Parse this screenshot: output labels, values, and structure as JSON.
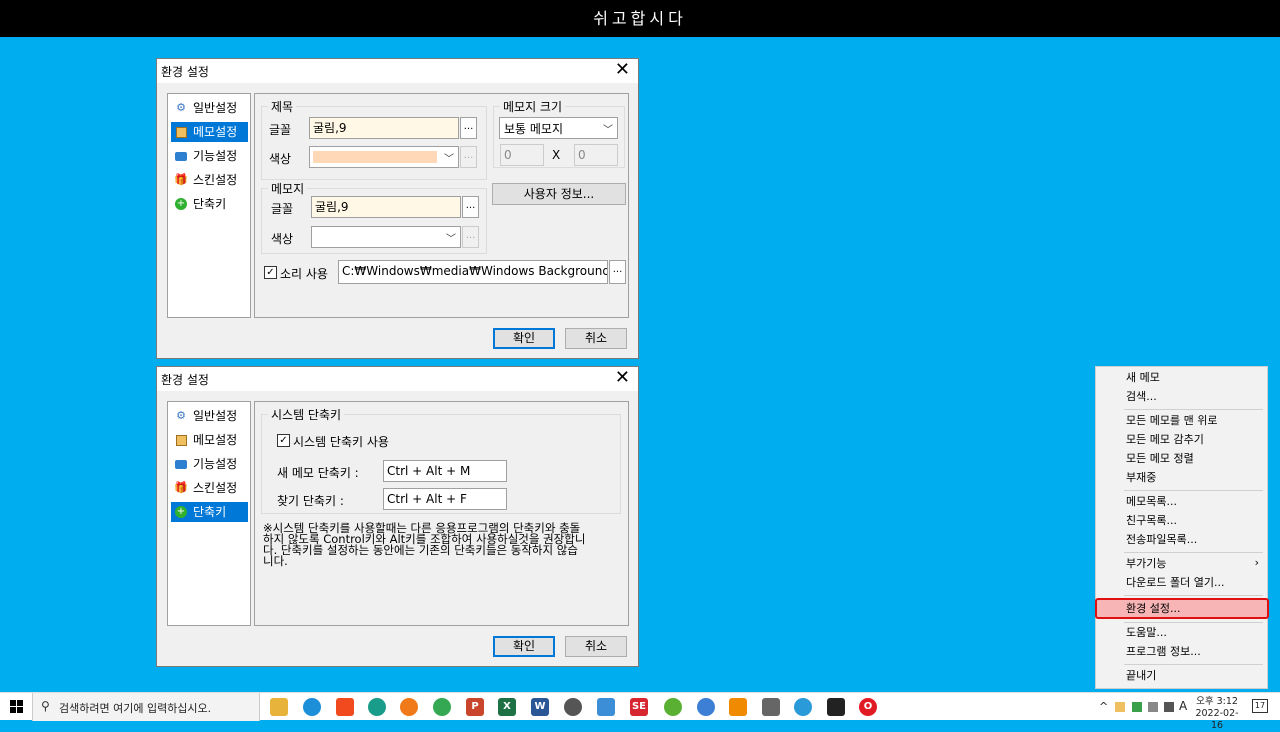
{
  "topbar": {
    "title": "쉬고합시다"
  },
  "dialog1": {
    "title": "환경 설정",
    "nav": [
      "일반설정",
      "메모설정",
      "기능설정",
      "스킨설정",
      "단축키"
    ],
    "selected_index": 1,
    "title_group": {
      "legend": "제목",
      "font_label": "글꼴",
      "font_value": "굴림,9",
      "color_label": "색상"
    },
    "memo_size": {
      "legend": "메모지 크기",
      "combo_value": "보통 메모지",
      "width_value": "0",
      "x_label": "X",
      "height_value": "0"
    },
    "user_info_button": "사용자 정보...",
    "memo_group": {
      "legend": "메모지",
      "font_label": "글꼴",
      "font_value": "굴림,9",
      "color_label": "색상"
    },
    "sound": {
      "label": "소리 사용",
      "checked": true,
      "path": "C:₩Windows₩media₩Windows Background.wa"
    },
    "ok": "확인",
    "cancel": "취소",
    "dots": "..."
  },
  "dialog2": {
    "title": "환경 설정",
    "nav": [
      "일반설정",
      "메모설정",
      "기능설정",
      "스킨설정",
      "단축키"
    ],
    "selected_index": 4,
    "group_legend": "시스템 단축키",
    "use_label": "시스템 단축키 사용",
    "use_checked": true,
    "new_memo_label": "새 메모 단축키 :",
    "new_memo_value": "Ctrl + Alt + M",
    "find_label": "찾기 단축키 :",
    "find_value": "Ctrl + Alt + F",
    "note_lines": [
      "※시스템 단축키를 사용할때는 다른 응용프로그램의 단축키와 충돌",
      "하지 않도록 Control키와 Alt키를 조합하여 사용하실것을 권장합니",
      "다. 단축키를 설정하는 동안에는 기존의 단축키들은 동작하지 않습",
      "니다."
    ],
    "ok": "확인",
    "cancel": "취소"
  },
  "context_menu": {
    "groups": [
      [
        "새 메모",
        "검색..."
      ],
      [
        "모든 메모를 맨 위로",
        "모든 메모 감추기",
        "모든 메모 정렬",
        "부재중"
      ],
      [
        "메모목록...",
        "친구목록...",
        "전송파일목록..."
      ],
      [
        "부가기능",
        "다운로드 폴더 열기..."
      ],
      [
        "환경 설정..."
      ],
      [
        "도움말...",
        "프로그램 정보..."
      ],
      [
        "끝내기"
      ]
    ],
    "submenu_arrow": "›",
    "highlighted": "환경 설정..."
  },
  "taskbar": {
    "search_placeholder": "검색하려면 여기에 입력하십시오.",
    "ime": "A",
    "time": "오후 3:12",
    "date": "2022-02-16",
    "notification_count": "17",
    "up_arrow": "^"
  }
}
